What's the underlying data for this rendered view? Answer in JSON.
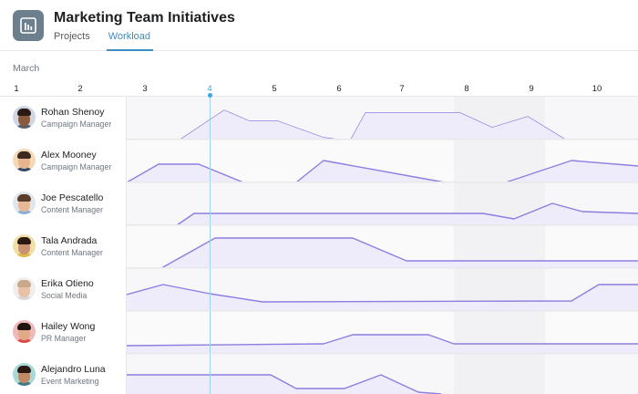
{
  "header": {
    "title": "Marketing Team Initiatives",
    "app_icon": "bar-chart-icon",
    "tabs": [
      {
        "label": "Projects",
        "active": false
      },
      {
        "label": "Workload",
        "active": true
      }
    ]
  },
  "calendar": {
    "month": "March",
    "days": [
      "1",
      "2",
      "3",
      "4",
      "5",
      "6",
      "7",
      "8",
      "9",
      "10"
    ],
    "today": "4"
  },
  "colors": {
    "accent": "#3b8fc4",
    "today": "#3ba7e0",
    "workload_line": "#8a7fe0",
    "workload_fill": "#eeecfb",
    "weekend_shade": "#efeff2"
  },
  "people": [
    {
      "name": "Rohan Shenoy",
      "role": "Campaign Manager",
      "skin": "#8a5a3c",
      "hair": "#2a1a12",
      "shirt": "#5b5f66",
      "bg": "#cdd7e6"
    },
    {
      "name": "Alex Mooney",
      "role": "Campaign Manager",
      "skin": "#e8b48f",
      "hair": "#3a2a20",
      "shirt": "#2f4a6a",
      "bg": "#f4d9b8"
    },
    {
      "name": "Joe Pescatello",
      "role": "Content Manager",
      "skin": "#e6b896",
      "hair": "#5a3c28",
      "shirt": "#8ab0d8",
      "bg": "#dfe6ee"
    },
    {
      "name": "Tala Andrada",
      "role": "Content Manager",
      "skin": "#c99270",
      "hair": "#2a1a12",
      "shirt": "#e0b84c",
      "bg": "#f2dfa6"
    },
    {
      "name": "Erika Otieno",
      "role": "Social Media",
      "skin": "#e9c2a6",
      "hair": "#c8a78a",
      "shirt": "#d8d8d8",
      "bg": "#eeeeee"
    },
    {
      "name": "Hailey Wong",
      "role": "PR Manager",
      "skin": "#e0aa88",
      "hair": "#1e1410",
      "shirt": "#d84a4a",
      "bg": "#f0b8b8"
    },
    {
      "name": "Alejandro Luna",
      "role": "Event Marketing",
      "skin": "#c08a66",
      "hair": "#2a1a12",
      "shirt": "#3f7a8a",
      "bg": "#a8d8d8"
    }
  ]
}
